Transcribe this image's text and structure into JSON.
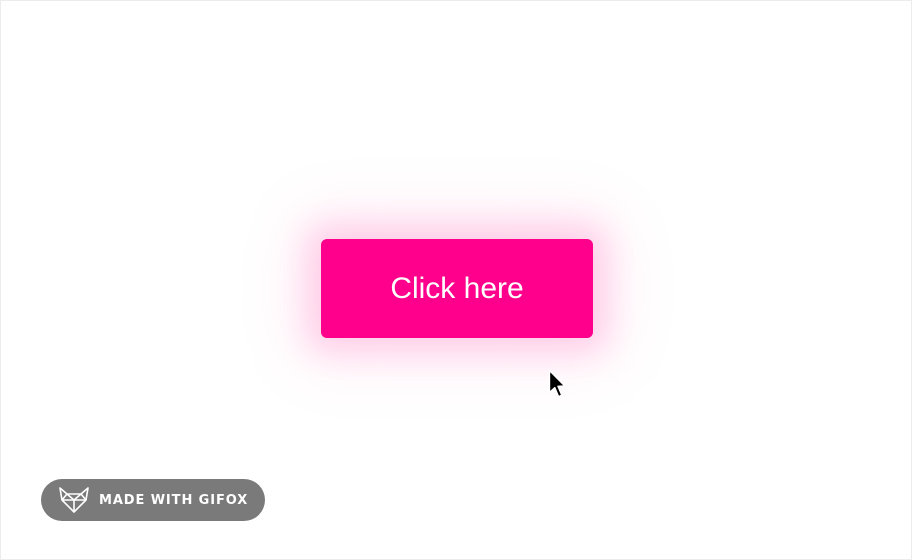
{
  "button": {
    "label": "Click here",
    "color": "#ff008c",
    "text_color": "#ffffff"
  },
  "cursor": {
    "icon": "pointer-arrow-icon"
  },
  "badge": {
    "icon": "fox-logo-icon",
    "text": "MADE WITH GIFOX",
    "color": "#7a7a7a"
  }
}
